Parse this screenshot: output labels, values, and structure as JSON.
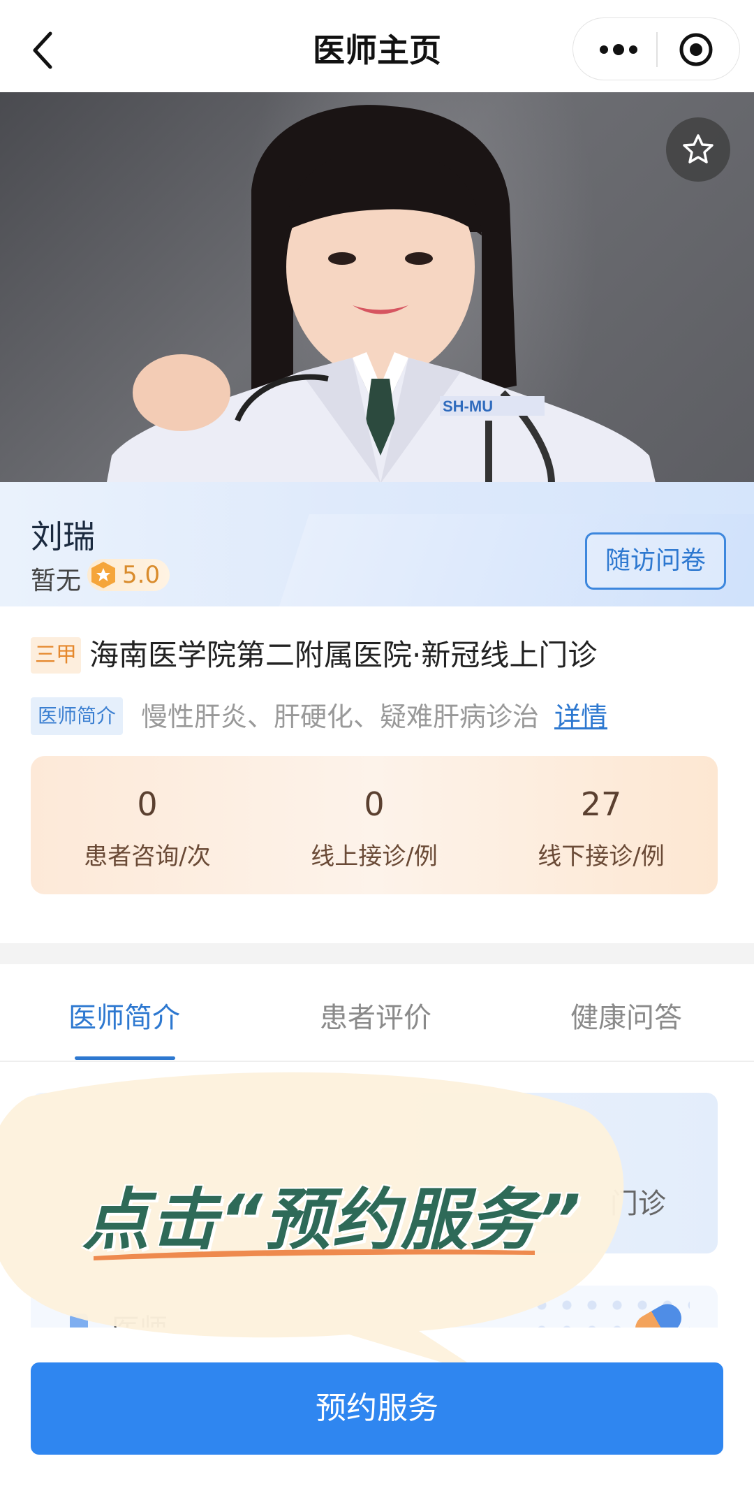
{
  "nav": {
    "title": "医师主页"
  },
  "doctor": {
    "name": "刘瑞",
    "rank": "暂无",
    "score": "5.0",
    "survey_label": "随访问卷",
    "hospital_grade": "三甲",
    "hospital_name": "海南医学院第二附属医院·新冠线上门诊",
    "intro_tag": "医师简介",
    "intro_text": "慢性肝炎、肝硬化、疑难肝病诊治",
    "intro_more": "详情"
  },
  "stats": [
    {
      "value": "0",
      "label": "患者咨询/次"
    },
    {
      "value": "0",
      "label": "线上接诊/例"
    },
    {
      "value": "27",
      "label": "线下接诊/例"
    }
  ],
  "tabs": [
    {
      "label": "医师简介",
      "active": true
    },
    {
      "label": "患者评价",
      "active": false
    },
    {
      "label": "健康问答",
      "active": false
    }
  ],
  "content": {
    "snippet": "门诊",
    "partial_heading": "医师"
  },
  "overlay": {
    "text": "点击“预约服务”"
  },
  "footer": {
    "book_label": "预约服务"
  },
  "colors": {
    "primary": "#2f86f0",
    "link": "#2d78d0",
    "overlay_text": "#2e6a58",
    "bubble": "#fdf1dd"
  }
}
